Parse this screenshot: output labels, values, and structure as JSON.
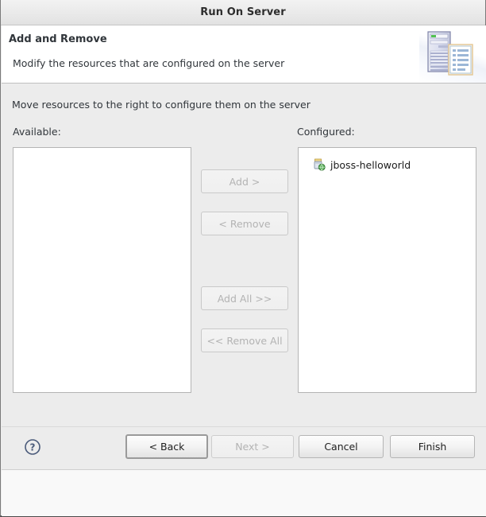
{
  "window": {
    "title": "Run On Server"
  },
  "header": {
    "title": "Add and Remove",
    "description": "Modify the resources that are configured on the server",
    "icon": "server-and-document-icon"
  },
  "main": {
    "instruction": "Move resources to the right to configure them on the server",
    "available": {
      "label": "Available:",
      "items": []
    },
    "configured": {
      "label": "Configured:",
      "items": [
        {
          "label": "jboss-helloworld",
          "icon": "web-module-icon"
        }
      ]
    },
    "transfer_buttons": [
      {
        "label": "Add >",
        "enabled": false,
        "name": "add-button"
      },
      {
        "label": "< Remove",
        "enabled": false,
        "name": "remove-button"
      },
      {
        "label": "Add All >>",
        "enabled": false,
        "name": "add-all-button"
      },
      {
        "label": "<< Remove All",
        "enabled": false,
        "name": "remove-all-button"
      }
    ]
  },
  "footer": {
    "help_icon": "help-question-icon",
    "buttons": {
      "back": "< Back",
      "next": "Next >",
      "cancel": "Cancel",
      "finish": "Finish"
    }
  },
  "colors": {
    "dialog_background": "#ececec",
    "header_background": "#ffffff",
    "list_background": "#ffffff",
    "text": "#31363b",
    "disabled_text": "#b3b3b3",
    "help_icon": "#4a5a7a"
  }
}
